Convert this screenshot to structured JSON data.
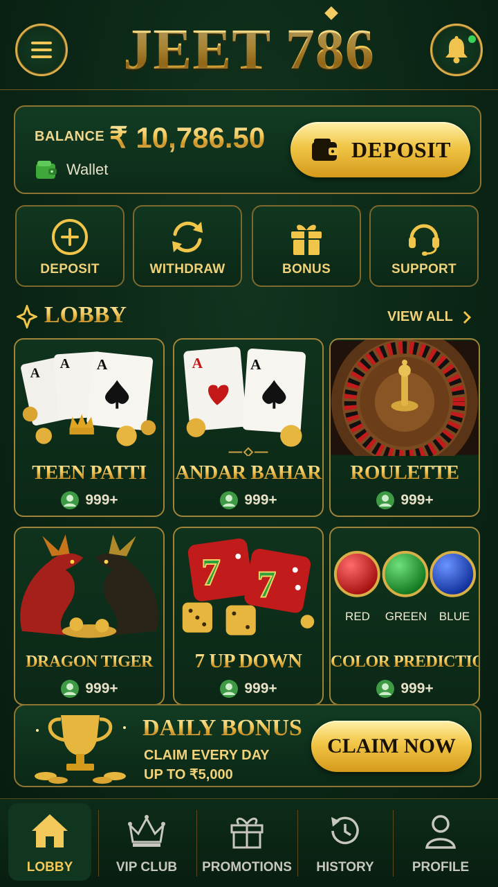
{
  "header": {
    "brand": "JEET 786",
    "menu_icon": "hamburger-menu-icon",
    "bell_icon": "bell-icon",
    "has_notification": true
  },
  "balance": {
    "label": "BALANCE",
    "amount": "₹ 10,786.50",
    "wallet_label": "Wallet",
    "deposit_button": "DEPOSIT"
  },
  "quick_actions": [
    {
      "label": "DEPOSIT",
      "icon": "plus-circle-icon"
    },
    {
      "label": "WITHDRAW",
      "icon": "refresh-arrows-icon"
    },
    {
      "label": "BONUS",
      "icon": "gift-icon"
    },
    {
      "label": "SUPPORT",
      "icon": "headset-icon"
    }
  ],
  "lobby": {
    "title": "LOBBY",
    "view_all": "VIEW ALL",
    "games": [
      {
        "title": "TEEN PATTI",
        "players": "999+"
      },
      {
        "title": "ANDAR BAHAR",
        "players": "999+"
      },
      {
        "title": "ROULETTE",
        "players": "999+"
      },
      {
        "title": "DRAGON TIGER",
        "players": "999+"
      },
      {
        "title": "7 UP DOWN",
        "players": "999+"
      },
      {
        "title": "COLOR PREDICTION",
        "players": "999+",
        "colors": [
          "RED",
          "GREEN",
          "BLUE"
        ]
      }
    ]
  },
  "daily_bonus": {
    "title": "DAILY BONUS",
    "line1": "CLAIM EVERY DAY",
    "line2": "UP TO ₹5,000",
    "button": "CLAIM NOW"
  },
  "bottom_nav": [
    {
      "label": "LOBBY",
      "icon": "home-icon",
      "active": true
    },
    {
      "label": "VIP CLUB",
      "icon": "crown-icon",
      "active": false
    },
    {
      "label": "PROMOTIONS",
      "icon": "gift-icon",
      "active": false
    },
    {
      "label": "HISTORY",
      "icon": "history-icon",
      "active": false
    },
    {
      "label": "PROFILE",
      "icon": "user-icon",
      "active": false
    }
  ],
  "colors": {
    "gold": "#f2c75a",
    "background": "#0b2616",
    "red": "#d11a1a",
    "green": "#1c9a2b",
    "blue": "#1f4fd6"
  }
}
